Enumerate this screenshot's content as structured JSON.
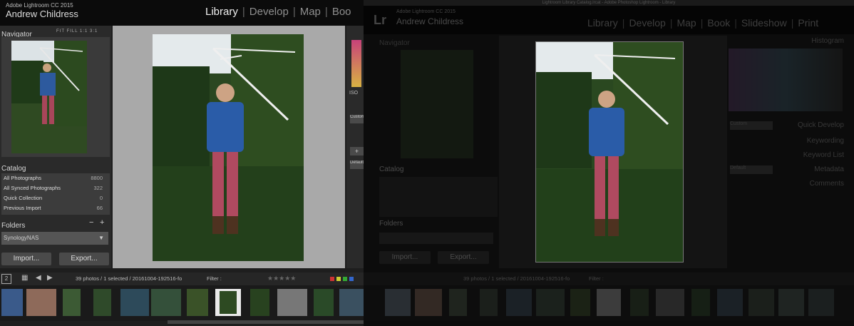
{
  "app": {
    "name": "Adobe Lightroom CC 2015",
    "user": "Andrew Childress"
  },
  "right_window_title": "Lightroom Library Catalog.lrcat - Adobe Photoshop Lightroom - Library",
  "modules": [
    "Library",
    "Develop",
    "Map",
    "Boo"
  ],
  "modules_right": [
    "Library",
    "Develop",
    "Map",
    "Book",
    "Slideshow",
    "Print"
  ],
  "navigator": {
    "title": "Navigator",
    "options": "FIT  FILL  1:1  3:1"
  },
  "catalog": {
    "title": "Catalog",
    "rows": [
      {
        "label": "All Photographs",
        "count": "8800"
      },
      {
        "label": "All Synced Photographs",
        "count": "322"
      },
      {
        "label": "Quick Collection",
        "count": "0"
      },
      {
        "label": "Previous Import",
        "count": "66"
      }
    ]
  },
  "folders": {
    "title": "Folders",
    "volume": "SynologyNAS",
    "minus": "−",
    "plus": "+"
  },
  "buttons": {
    "import": "Import...",
    "export": "Export..."
  },
  "filmstrip": {
    "page": "2",
    "info": "39 photos / 1 selected / 20161004-192516-fo",
    "filter": "Filter :"
  },
  "right_panels": {
    "histogram": "Histogram",
    "quick_develop": "Quick Develop",
    "keywording": "Keywording",
    "keyword_list": "Keyword List",
    "metadata": "Metadata",
    "comments": "Comments",
    "iso": "ISO",
    "custom": "Custom",
    "default": "Default"
  },
  "colors": {
    "accent": "#e6e6e6",
    "panel": "#333333",
    "bg": "#1e1e1e"
  }
}
